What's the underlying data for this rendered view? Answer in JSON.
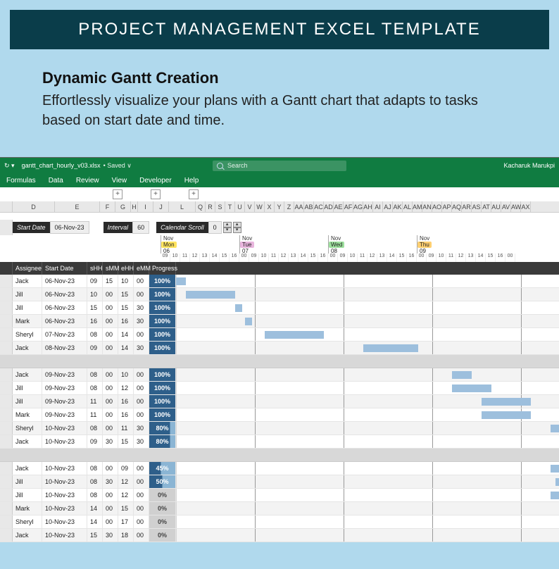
{
  "banner": {
    "title": "PROJECT MANAGEMENT EXCEL TEMPLATE"
  },
  "hero": {
    "title": "Dynamic Gantt Creation",
    "text": "Effortlessly visualize your plans with a Gantt chart that adapts to tasks based on start date and time."
  },
  "titlebar": {
    "filename": "gantt_chart_hourly_v03.xlsx",
    "saved": "• Saved ∨",
    "search_placeholder": "Search",
    "user": "Kacharuk Marukpi"
  },
  "ribbon": [
    "Formulas",
    "Data",
    "Review",
    "View",
    "Developer",
    "Help"
  ],
  "mini_btns": [
    "+",
    "+",
    "+"
  ],
  "col_letters": [
    "D",
    "E",
    "F",
    "G",
    "H",
    "I",
    "J",
    "L",
    "Q",
    "R",
    "S",
    "T",
    "U",
    "V",
    "W",
    "X",
    "Y",
    "Z",
    "AA",
    "AB",
    "AC",
    "AD",
    "AE",
    "AF",
    "AG",
    "AH",
    "AI",
    "AJ",
    "AK",
    "AL",
    "AM",
    "AN",
    "AO",
    "AP",
    "AQ",
    "AR",
    "AS",
    "AT",
    "AU",
    "AV",
    "AW",
    "AX"
  ],
  "controls": {
    "start_label": "Start Date",
    "start_val": "06-Nov-23",
    "interval_label": "Interval",
    "interval_val": "60",
    "scroll_label": "Calendar Scroll",
    "scroll_val": "0"
  },
  "days": [
    {
      "month": "Nov",
      "name": "Mon",
      "num": "06",
      "color": "#ffe45e"
    },
    {
      "month": "Nov",
      "name": "Tue",
      "num": "07",
      "color": "#e8b5dd"
    },
    {
      "month": "Nov",
      "name": "Wed",
      "num": "08",
      "color": "#9de09d"
    },
    {
      "month": "Nov",
      "name": "Thu",
      "num": "09",
      "color": "#ffcf70"
    }
  ],
  "hours": [
    "09",
    "10",
    "11",
    "12",
    "13",
    "14",
    "15",
    "16",
    "00",
    "09",
    "10",
    "11",
    "12",
    "13",
    "14",
    "15",
    "16",
    "00",
    "09",
    "10",
    "11",
    "12",
    "13",
    "14",
    "15",
    "16",
    "00",
    "09",
    "10",
    "11",
    "12",
    "13",
    "14",
    "15",
    "16",
    "00"
  ],
  "task_headers": [
    "Assignee",
    "Start Date",
    "sHH",
    "sMM",
    "eHH",
    "eMM",
    "Progress"
  ],
  "tasks": [
    {
      "a": "Jack",
      "d": "06-Nov-23",
      "sh": "09",
      "sm": "15",
      "eh": "10",
      "em": "00",
      "p": "100%",
      "pc": "p100",
      "bar": [
        0,
        14
      ]
    },
    {
      "a": "Jill",
      "d": "06-Nov-23",
      "sh": "10",
      "sm": "00",
      "eh": "15",
      "em": "00",
      "p": "100%",
      "pc": "p100",
      "bar": [
        14,
        70
      ]
    },
    {
      "a": "Jill",
      "d": "06-Nov-23",
      "sh": "15",
      "sm": "00",
      "eh": "15",
      "em": "30",
      "p": "100%",
      "pc": "p100",
      "bar": [
        84,
        10
      ]
    },
    {
      "a": "Mark",
      "d": "06-Nov-23",
      "sh": "16",
      "sm": "00",
      "eh": "16",
      "em": "30",
      "p": "100%",
      "pc": "p100",
      "bar": [
        98,
        10
      ]
    },
    {
      "a": "Sheryl",
      "d": "07-Nov-23",
      "sh": "08",
      "sm": "00",
      "eh": "14",
      "em": "00",
      "p": "100%",
      "pc": "p100",
      "bar": [
        126,
        84
      ]
    },
    {
      "a": "Jack",
      "d": "08-Nov-23",
      "sh": "09",
      "sm": "00",
      "eh": "14",
      "em": "30",
      "p": "100%",
      "pc": "p100",
      "bar": [
        266,
        78
      ]
    },
    {
      "group": true
    },
    {
      "a": "Jack",
      "d": "09-Nov-23",
      "sh": "08",
      "sm": "00",
      "eh": "10",
      "em": "00",
      "p": "100%",
      "pc": "p100",
      "bar": [
        392,
        28
      ]
    },
    {
      "a": "Jill",
      "d": "09-Nov-23",
      "sh": "08",
      "sm": "00",
      "eh": "12",
      "em": "00",
      "p": "100%",
      "pc": "p100",
      "bar": [
        392,
        56
      ]
    },
    {
      "a": "Jill",
      "d": "09-Nov-23",
      "sh": "11",
      "sm": "00",
      "eh": "16",
      "em": "00",
      "p": "100%",
      "pc": "p100",
      "bar": [
        434,
        70
      ]
    },
    {
      "a": "Mark",
      "d": "09-Nov-23",
      "sh": "11",
      "sm": "00",
      "eh": "16",
      "em": "00",
      "p": "100%",
      "pc": "p100",
      "bar": [
        434,
        70
      ]
    },
    {
      "a": "Sheryl",
      "d": "10-Nov-23",
      "sh": "08",
      "sm": "00",
      "eh": "11",
      "em": "30",
      "p": "80%",
      "pc": "p80",
      "bar": [
        532,
        50
      ]
    },
    {
      "a": "Jack",
      "d": "10-Nov-23",
      "sh": "09",
      "sm": "30",
      "eh": "15",
      "em": "30",
      "p": "80%",
      "pc": "p80",
      "bar": [
        553,
        84
      ]
    },
    {
      "group": true
    },
    {
      "a": "Jack",
      "d": "10-Nov-23",
      "sh": "08",
      "sm": "00",
      "eh": "09",
      "em": "00",
      "p": "45%",
      "pc": "p45",
      "bar": [
        532,
        14
      ]
    },
    {
      "a": "Jill",
      "d": "10-Nov-23",
      "sh": "08",
      "sm": "30",
      "eh": "12",
      "em": "00",
      "p": "50%",
      "pc": "p50",
      "bar": [
        539,
        50
      ]
    },
    {
      "a": "Jill",
      "d": "10-Nov-23",
      "sh": "08",
      "sm": "00",
      "eh": "12",
      "em": "00",
      "p": "0%",
      "pc": "p0",
      "bar": [
        532,
        56
      ]
    },
    {
      "a": "Mark",
      "d": "10-Nov-23",
      "sh": "14",
      "sm": "00",
      "eh": "15",
      "em": "00",
      "p": "0%",
      "pc": "p0",
      "bar": [
        616,
        14
      ]
    },
    {
      "a": "Sheryl",
      "d": "10-Nov-23",
      "sh": "14",
      "sm": "00",
      "eh": "17",
      "em": "00",
      "p": "0%",
      "pc": "p0",
      "bar": [
        616,
        42
      ]
    },
    {
      "a": "Jack",
      "d": "10-Nov-23",
      "sh": "15",
      "sm": "30",
      "eh": "18",
      "em": "00",
      "p": "0%",
      "pc": "p0",
      "bar": [
        637,
        36
      ]
    }
  ],
  "col_widths": {
    "assignee": 60,
    "date": 64,
    "hh": 22,
    "mm": 22,
    "progress": 38,
    "data_left": 228,
    "hour_w": 14
  }
}
